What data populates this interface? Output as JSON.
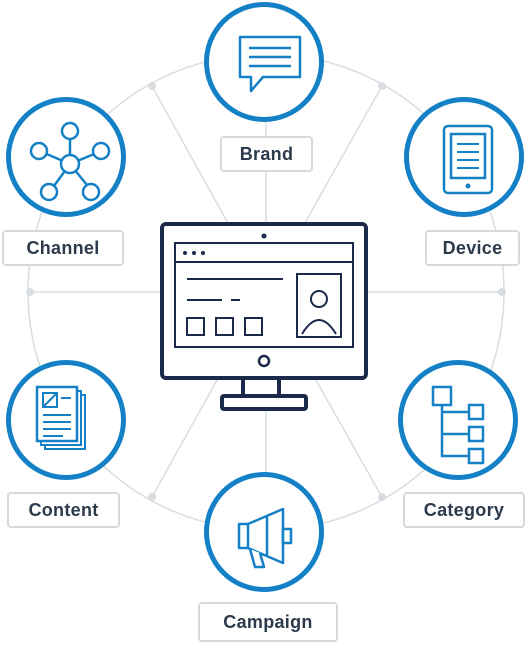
{
  "diagram": {
    "nodes": [
      {
        "id": "brand",
        "label": "Brand",
        "icon": "chat-bubble-icon"
      },
      {
        "id": "device",
        "label": "Device",
        "icon": "tablet-icon"
      },
      {
        "id": "category",
        "label": "Category",
        "icon": "hierarchy-icon"
      },
      {
        "id": "campaign",
        "label": "Campaign",
        "icon": "megaphone-icon"
      },
      {
        "id": "content",
        "label": "Content",
        "icon": "document-stack-icon"
      },
      {
        "id": "channel",
        "label": "Channel",
        "icon": "network-icon"
      }
    ],
    "center_icon": "computer-monitor-icon",
    "colors": {
      "accent": "#1481c6",
      "monitor": "#1b2a4a",
      "ring": "#d9dde1",
      "label_border": "#d4d9de",
      "label_text": "#2c3a4b"
    }
  }
}
